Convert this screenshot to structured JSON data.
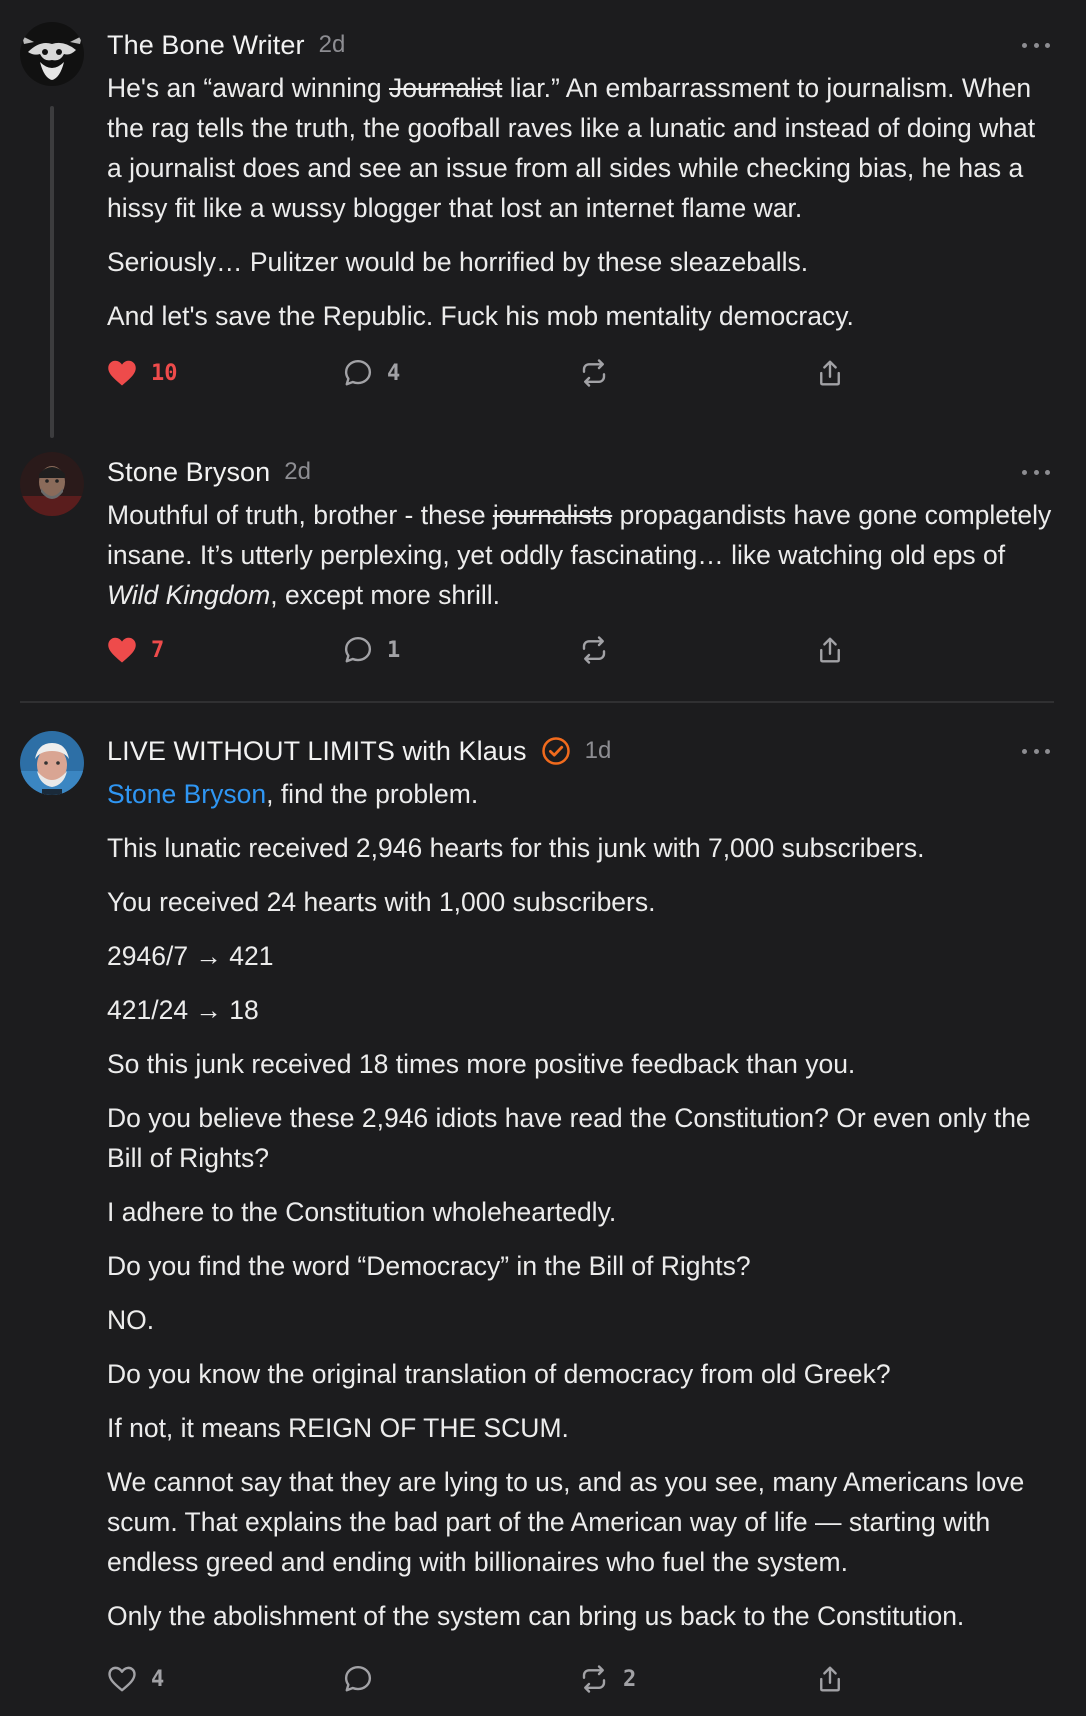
{
  "comments": [
    {
      "author": "The Bone Writer",
      "time": "2d",
      "paragraphs": {
        "p1_pre": "He's an “award winning ",
        "p1_strike": "Journalist",
        "p1_post": " liar.” An embarrassment to journalism. When the rag tells the truth, the goofball raves like a lunatic and instead of doing what a journalist does and see an issue from all sides while checking bias, he has a hissy fit like a wussy blogger that lost an internet flame war.",
        "p2": "Seriously… Pulitzer would be horrified by these sleazeballs.",
        "p3": "And let's save the Republic. Fuck his mob mentality democracy."
      },
      "likes": "10",
      "replies": "4",
      "restacks": "",
      "liked": true
    },
    {
      "author": "Stone Bryson",
      "time": "2d",
      "paragraphs": {
        "p1_pre": "Mouthful of truth, brother - these ",
        "p1_strike": "journalists",
        "p1_mid": " propagandists have gone completely insane. It’s utterly perplexing, yet oddly fascinating… like watching old eps of ",
        "p1_italic": "Wild Kingdom",
        "p1_post": ", except more shrill."
      },
      "likes": "7",
      "replies": "1",
      "restacks": "",
      "liked": true
    },
    {
      "author": "LIVE WITHOUT LIMITS with Klaus",
      "time": "1d",
      "verified": true,
      "mention": "Stone Bryson",
      "paragraphs": {
        "p1_post": ", find the problem.",
        "p2": "This lunatic received 2,946 hearts for this junk with 7,000 subscribers.",
        "p3": "You received 24 hearts with 1,000 subscribers.",
        "p4": "2946/7 → 421",
        "p5": "421/24 → 18",
        "p6": "So this junk received 18 times more positive feedback than you.",
        "p7": "Do you believe these 2,946 idiots have read the Constitution? Or even only the Bill of Rights?",
        "p8": "I adhere to the Constitution wholeheartedly.",
        "p9": "Do you find the word “Democracy” in the Bill of Rights?",
        "p10": "NO.",
        "p11": "Do you know the original translation of democracy from old Greek?",
        "p12": "If not, it means REIGN OF THE SCUM.",
        "p13": "We cannot say that they are lying to us, and as you see, many Americans love scum. That explains the bad part of the American way of life — starting with endless greed and ending with billionaires who fuel the system.",
        "p14": "Only the abolishment of the system can bring us back to the Constitution."
      },
      "likes": "4",
      "replies": "",
      "restacks": "2",
      "liked": false
    }
  ],
  "colors": {
    "background": "#1c1c1e",
    "like_active": "#ee4b4b",
    "mention": "#2f96f3",
    "verified": "#f26b1d",
    "muted": "#8d8d92"
  },
  "icons": [
    "heart-icon",
    "comment-icon",
    "restack-icon",
    "share-icon",
    "more-icon",
    "verified-icon"
  ]
}
